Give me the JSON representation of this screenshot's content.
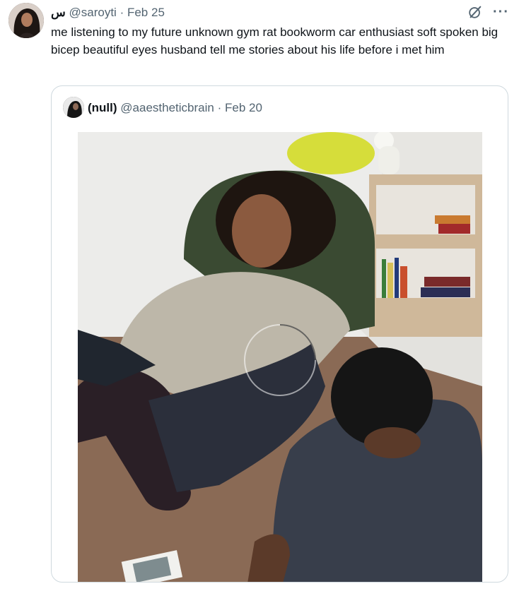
{
  "tweet": {
    "author_name": "س",
    "handle": "@saroyti",
    "separator": "·",
    "date": "Feb 25",
    "text": "me listening to my future unknown gym rat bookworm car enthusiast soft spoken big bicep beautiful eyes husband tell me stories about his life before i met him",
    "more_icon": "more-dots-icon",
    "grok_icon": "grok-icon"
  },
  "quoted": {
    "author_name": "(null)",
    "handle": "@aaestheticbrain",
    "separator": "·",
    "date": "Feb 20",
    "media_alt": "photo"
  },
  "colors": {
    "text": "#0f1419",
    "secondary": "#536471",
    "border": "#cfd9de"
  }
}
